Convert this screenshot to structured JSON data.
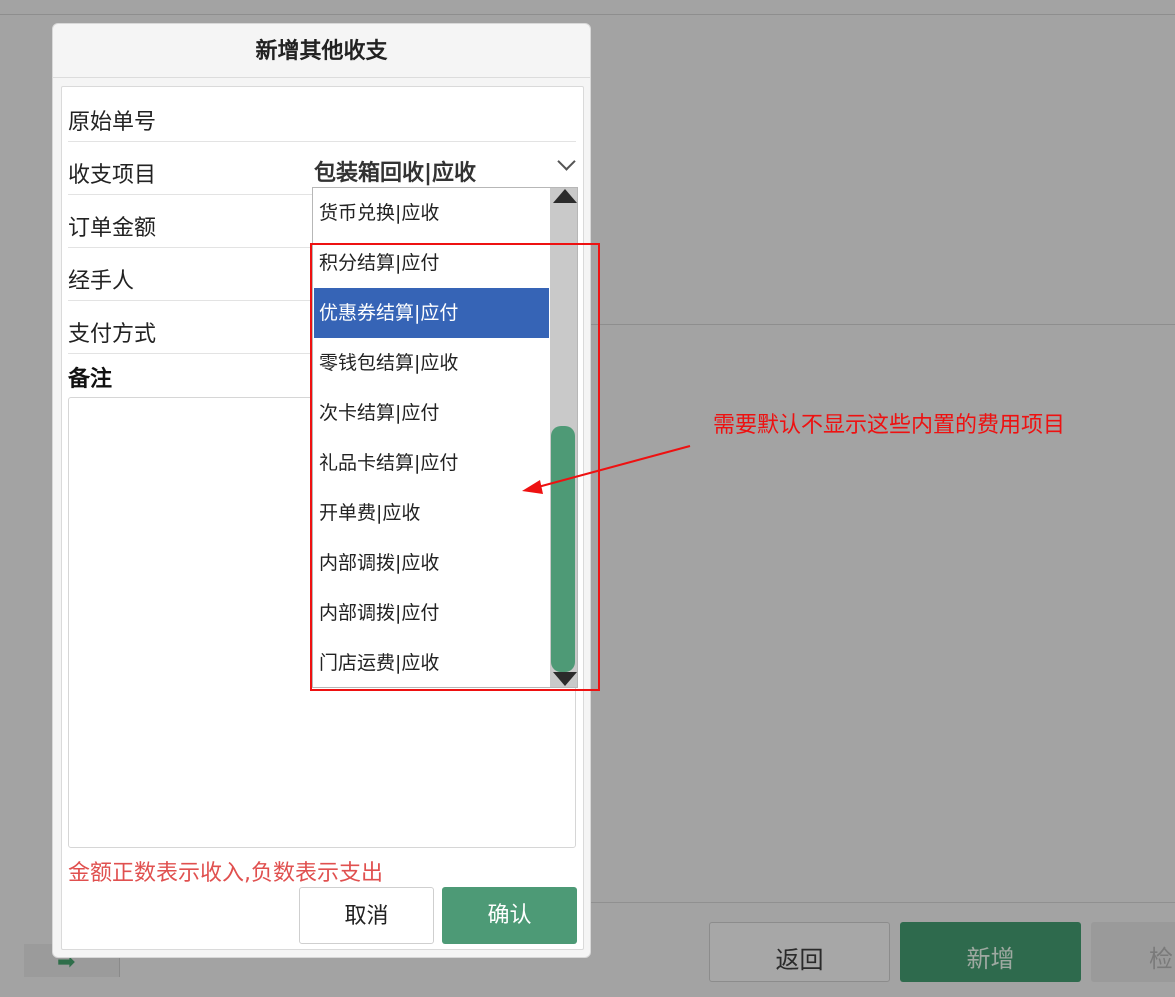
{
  "background": {
    "buttons": {
      "back": "返回",
      "add": "新增",
      "more": "检"
    },
    "footer_icon": "arrow-right-icon"
  },
  "dialog": {
    "title": "新增其他收支",
    "fields": [
      {
        "label": "原始单号",
        "value": ""
      },
      {
        "label": "收支项目",
        "value": "包装箱回收|应收"
      },
      {
        "label": "订单金额",
        "value": ""
      },
      {
        "label": "经手人",
        "value": ""
      },
      {
        "label": "支付方式",
        "value": ""
      }
    ],
    "remark_label": "备注",
    "remark_value": "",
    "hint": "金额正数表示收入,负数表示支出",
    "cancel_label": "取消",
    "confirm_label": "确认"
  },
  "dropdown": {
    "options": [
      "货币兑换|应收",
      "积分结算|应付",
      "优惠券结算|应付",
      "零钱包结算|应收",
      "次卡结算|应付",
      "礼品卡结算|应付",
      "开单费|应收",
      "内部调拨|应收",
      "内部调拨|应付",
      "门店运费|应收"
    ],
    "selected": "优惠券结算|应付"
  },
  "annotation": {
    "text": "需要默认不显示这些内置的费用项目",
    "color": "#ee1111"
  },
  "colors": {
    "accent_green": "#4d9a76",
    "selected_blue": "#3664b6",
    "hint_red": "#e0504f"
  }
}
